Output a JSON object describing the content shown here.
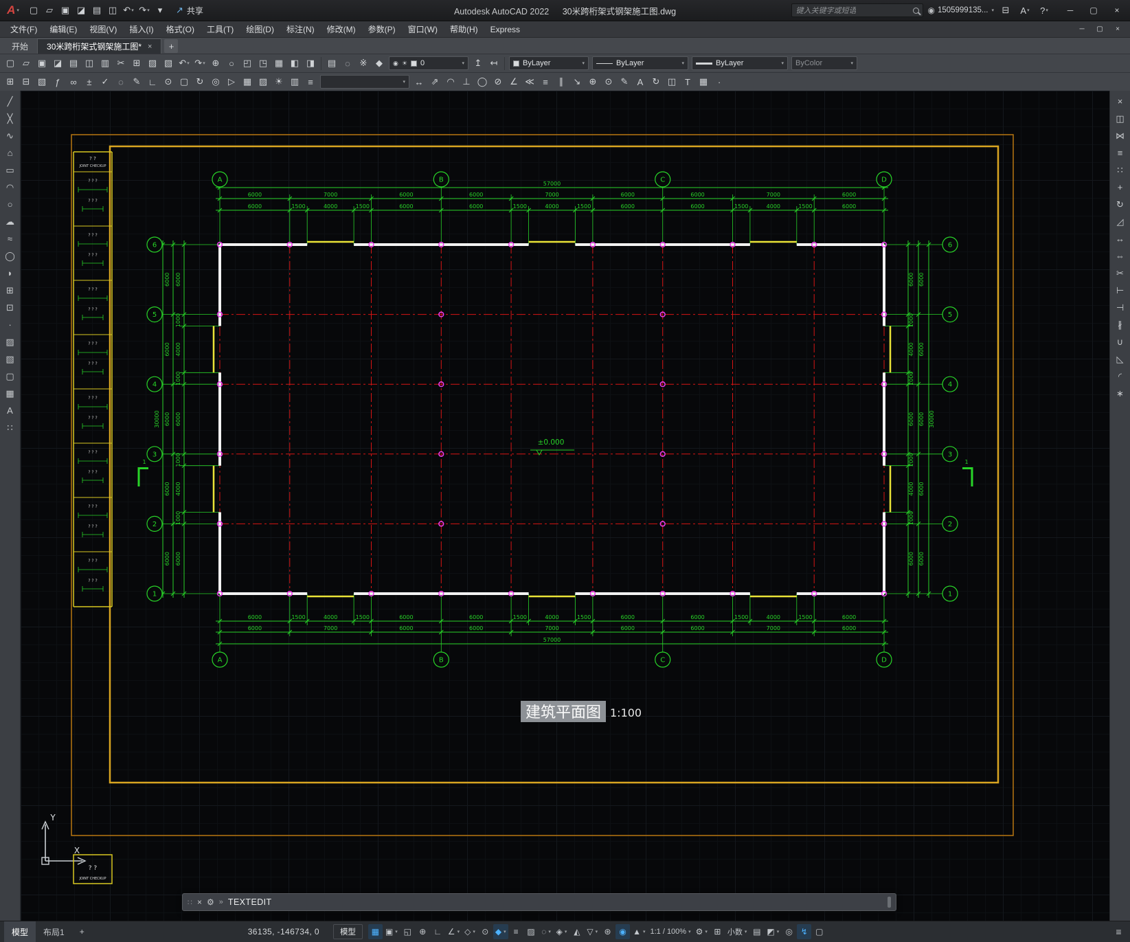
{
  "titlebar": {
    "logo_letter": "A",
    "app_title": "Autodesk AutoCAD 2022",
    "doc_title": "30米跨桁架式钢架施工图.dwg",
    "search_placeholder": "键入关键字或短语",
    "account_label": "1505999135...",
    "share_label": "共享",
    "qat": [
      {
        "name": "new-file",
        "glyph": "▢"
      },
      {
        "name": "open-file",
        "glyph": "▱"
      },
      {
        "name": "save",
        "glyph": "▣"
      },
      {
        "name": "save-as",
        "glyph": "◪"
      },
      {
        "name": "plot",
        "glyph": "▤"
      },
      {
        "name": "batch-plot",
        "glyph": "◫"
      },
      {
        "name": "undo",
        "glyph": "↶",
        "caret": true
      },
      {
        "name": "redo",
        "glyph": "↷",
        "caret": true
      },
      {
        "name": "qat-customize",
        "glyph": "▾"
      }
    ],
    "window_controls": [
      {
        "name": "minimize",
        "glyph": "─"
      },
      {
        "name": "maximize",
        "glyph": "▢"
      },
      {
        "name": "close",
        "glyph": "×"
      }
    ]
  },
  "menubar": {
    "items": [
      "文件(F)",
      "编辑(E)",
      "视图(V)",
      "插入(I)",
      "格式(O)",
      "工具(T)",
      "绘图(D)",
      "标注(N)",
      "修改(M)",
      "参数(P)",
      "窗口(W)",
      "帮助(H)",
      "Express"
    ],
    "window_controls": [
      {
        "name": "doc-minimize",
        "glyph": "─"
      },
      {
        "name": "doc-restore",
        "glyph": "▢"
      },
      {
        "name": "doc-close",
        "glyph": "×"
      }
    ]
  },
  "tabbar": {
    "start_tab": "开始",
    "doc_tab": "30米跨桁架式钢架施工图*"
  },
  "toolbar1": {
    "icons_main": [
      {
        "name": "qnew",
        "glyph": "▢"
      },
      {
        "name": "open",
        "glyph": "▱"
      },
      {
        "name": "save",
        "glyph": "▣"
      },
      {
        "name": "save-as",
        "glyph": "◪"
      },
      {
        "name": "plot",
        "glyph": "▤"
      },
      {
        "name": "plot-preview",
        "glyph": "◫"
      },
      {
        "name": "publish",
        "glyph": "▥"
      },
      {
        "name": "cut",
        "glyph": "✂"
      },
      {
        "name": "copy",
        "glyph": "⊞"
      },
      {
        "name": "paste",
        "glyph": "▨"
      },
      {
        "name": "match-properties",
        "glyph": "▧"
      },
      {
        "name": "undo",
        "glyph": "↶",
        "caret": true
      },
      {
        "name": "redo",
        "glyph": "↷",
        "caret": true
      },
      {
        "name": "pan",
        "glyph": "⊕"
      },
      {
        "name": "zoom-realtime",
        "glyph": "○"
      },
      {
        "name": "zoom-window",
        "glyph": "◰"
      },
      {
        "name": "zoom-previous",
        "glyph": "◳"
      },
      {
        "name": "properties-palette",
        "glyph": "▦"
      },
      {
        "name": "design-center",
        "glyph": "◧"
      },
      {
        "name": "tool-palettes",
        "glyph": "◨"
      }
    ],
    "icons_layer": [
      {
        "name": "layer-properties",
        "glyph": "▤"
      },
      {
        "name": "layer-off",
        "glyph": "◌"
      },
      {
        "name": "layer-freeze",
        "glyph": "※"
      },
      {
        "name": "layer-lock",
        "glyph": "◆"
      }
    ],
    "layer_value": "0",
    "icons_layer2": [
      {
        "name": "make-object-layer-current",
        "glyph": "↥"
      },
      {
        "name": "layer-previous",
        "glyph": "↤"
      }
    ],
    "color_value": "ByLayer",
    "linetype_value": "ByLayer",
    "lineweight_value": "ByLayer",
    "plotstyle_value": "ByColor"
  },
  "toolbar2": {
    "icons_left": [
      {
        "name": "insert-block",
        "glyph": "⊞"
      },
      {
        "name": "attach-xref",
        "glyph": "⊟"
      },
      {
        "name": "attach-image",
        "glyph": "▧"
      },
      {
        "name": "field",
        "glyph": "ƒ"
      },
      {
        "name": "hyperlink",
        "glyph": "∞"
      },
      {
        "name": "quick-calc",
        "glyph": "±"
      },
      {
        "name": "spell-check",
        "glyph": "✓"
      },
      {
        "name": "find-replace",
        "glyph": "◌"
      },
      {
        "name": "markup",
        "glyph": "✎"
      },
      {
        "name": "ucs",
        "glyph": "∟"
      },
      {
        "name": "ucs-world",
        "glyph": "⊙"
      },
      {
        "name": "named-views",
        "glyph": "▢"
      },
      {
        "name": "3d-orbit",
        "glyph": "↻"
      },
      {
        "name": "steering-wheel",
        "glyph": "◎"
      },
      {
        "name": "show-motion",
        "glyph": "▷"
      },
      {
        "name": "render",
        "glyph": "▦"
      },
      {
        "name": "materials",
        "glyph": "▨"
      },
      {
        "name": "lights",
        "glyph": "☀"
      },
      {
        "name": "sheet-set-manager",
        "glyph": "▥"
      },
      {
        "name": "layer-walk",
        "glyph": "≡"
      }
    ],
    "style_value": "",
    "icons_right": [
      {
        "name": "dim-linear",
        "glyph": "↔"
      },
      {
        "name": "dim-aligned",
        "glyph": "⇗"
      },
      {
        "name": "dim-arc-length",
        "glyph": "◠"
      },
      {
        "name": "dim-ordinate",
        "glyph": "⊥"
      },
      {
        "name": "dim-radius",
        "glyph": "◯"
      },
      {
        "name": "dim-diameter",
        "glyph": "⊘"
      },
      {
        "name": "dim-angular",
        "glyph": "∠"
      },
      {
        "name": "quick-dimension",
        "glyph": "≪"
      },
      {
        "name": "dim-baseline",
        "glyph": "≡"
      },
      {
        "name": "dim-continue",
        "glyph": "∥"
      },
      {
        "name": "multileader",
        "glyph": "↘"
      },
      {
        "name": "tolerance",
        "glyph": "⊕"
      },
      {
        "name": "center-mark",
        "glyph": "⊙"
      },
      {
        "name": "dim-edit",
        "glyph": "✎"
      },
      {
        "name": "dim-text-edit",
        "glyph": "A"
      },
      {
        "name": "dim-update",
        "glyph": "↻"
      },
      {
        "name": "dim-style",
        "glyph": "◫"
      },
      {
        "name": "text-style",
        "glyph": "T"
      },
      {
        "name": "table-style",
        "glyph": "▦"
      },
      {
        "name": "point-style",
        "glyph": "∙"
      }
    ]
  },
  "left_palette": [
    {
      "name": "line",
      "glyph": "╱"
    },
    {
      "name": "construction-line",
      "glyph": "╳"
    },
    {
      "name": "polyline",
      "glyph": "∿"
    },
    {
      "name": "polygon",
      "glyph": "⌂"
    },
    {
      "name": "rectangle",
      "glyph": "▭"
    },
    {
      "name": "arc",
      "glyph": "◠"
    },
    {
      "name": "circle",
      "glyph": "○"
    },
    {
      "name": "revision-cloud",
      "glyph": "☁"
    },
    {
      "name": "spline",
      "glyph": "≈"
    },
    {
      "name": "ellipse",
      "glyph": "◯"
    },
    {
      "name": "ellipse-arc",
      "glyph": "◗"
    },
    {
      "name": "insert-block",
      "glyph": "⊞"
    },
    {
      "name": "make-block",
      "glyph": "⊡"
    },
    {
      "name": "point",
      "glyph": "∙"
    },
    {
      "name": "hatch",
      "glyph": "▨"
    },
    {
      "name": "gradient",
      "glyph": "▧"
    },
    {
      "name": "region",
      "glyph": "▢"
    },
    {
      "name": "table",
      "glyph": "▦"
    },
    {
      "name": "multiline-text",
      "glyph": "A"
    },
    {
      "name": "multiple-points",
      "glyph": "∷"
    }
  ],
  "right_palette": [
    {
      "name": "erase",
      "glyph": "×"
    },
    {
      "name": "copy-object",
      "glyph": "◫"
    },
    {
      "name": "mirror",
      "glyph": "⋈"
    },
    {
      "name": "offset",
      "glyph": "≡"
    },
    {
      "name": "array",
      "glyph": "∷"
    },
    {
      "name": "move",
      "glyph": "+"
    },
    {
      "name": "rotate",
      "glyph": "↻"
    },
    {
      "name": "scale",
      "glyph": "◿"
    },
    {
      "name": "stretch",
      "glyph": "↔"
    },
    {
      "name": "lengthen",
      "glyph": "⇔"
    },
    {
      "name": "trim",
      "glyph": "✂"
    },
    {
      "name": "extend",
      "glyph": "⊢"
    },
    {
      "name": "break-at-point",
      "glyph": "⊣"
    },
    {
      "name": "break",
      "glyph": "∦"
    },
    {
      "name": "join",
      "glyph": "∪"
    },
    {
      "name": "chamfer",
      "glyph": "◺"
    },
    {
      "name": "fillet",
      "glyph": "◜"
    },
    {
      "name": "explode",
      "glyph": "∗"
    }
  ],
  "command": {
    "prompt": "TEXTEDIT"
  },
  "statusbar": {
    "layout_tabs": [
      {
        "name": "model",
        "label": "模型",
        "active": true
      },
      {
        "name": "layout1",
        "label": "布局1"
      },
      {
        "name": "add-layout",
        "label": "+"
      }
    ],
    "coordinates": "36135, -146734, 0",
    "model_space_label": "模型",
    "items": [
      {
        "name": "grid-display",
        "glyph": "▦",
        "active": true
      },
      {
        "name": "snap-mode",
        "glyph": "▣",
        "caret": true
      },
      {
        "name": "infer-constraints",
        "glyph": "◱"
      },
      {
        "name": "dynamic-input",
        "glyph": "⊕"
      },
      {
        "name": "ortho-mode",
        "glyph": "∟"
      },
      {
        "name": "polar-tracking",
        "glyph": "∠",
        "caret": true
      },
      {
        "name": "isometric-drafting",
        "glyph": "◇",
        "caret": true
      },
      {
        "name": "object-snap-tracking",
        "glyph": "⊙"
      },
      {
        "name": "object-snap",
        "glyph": "◆",
        "active": true,
        "caret": true
      },
      {
        "name": "lineweight-display",
        "glyph": "≡"
      },
      {
        "name": "transparency",
        "glyph": "▨"
      },
      {
        "name": "selection-cycling",
        "glyph": "◌",
        "caret": true
      },
      {
        "name": "3d-object-snap",
        "glyph": "◈",
        "caret": true
      },
      {
        "name": "dynamic-ucs",
        "glyph": "◭"
      },
      {
        "name": "selection-filtering",
        "glyph": "▽",
        "caret": true
      },
      {
        "name": "gizmo",
        "glyph": "⊛"
      },
      {
        "name": "annotation-visibility",
        "glyph": "◉",
        "active": true
      },
      {
        "name": "autoscale",
        "glyph": "▲",
        "caret": true
      },
      {
        "name": "annotation-scale",
        "label": "1:1 / 100%",
        "caret": true
      },
      {
        "name": "workspace-switching",
        "glyph": "⚙",
        "caret": true
      },
      {
        "name": "annotation-monitor",
        "glyph": "⊞"
      },
      {
        "name": "units",
        "label": "小数",
        "caret": true
      },
      {
        "name": "quick-properties",
        "glyph": "▤"
      },
      {
        "name": "lock-ui",
        "glyph": "◩",
        "caret": true
      },
      {
        "name": "isolate-objects",
        "glyph": "◎"
      },
      {
        "name": "graphics-performance",
        "glyph": "↯",
        "active": true
      },
      {
        "name": "clean-screen",
        "glyph": "▢"
      }
    ]
  },
  "drawing": {
    "strip": {
      "header_marks": "?      ?",
      "label": "JOINT CHECKUP",
      "section_marks": "?    ?    ?",
      "section_count": 8
    },
    "col_axis_labels": [
      "A",
      "B",
      "C",
      "D"
    ],
    "col_axis_mm": [
      0,
      19000,
      38000,
      57000
    ],
    "row_axis_labels": [
      "6",
      "5",
      "4",
      "3",
      "2",
      "1"
    ],
    "row_axis_mm": [
      0,
      6000,
      12000,
      18000,
      24000,
      30000
    ],
    "total_width_label": "57000",
    "total_height_label": "30000",
    "bay_boundaries_mm": [
      0,
      6000,
      13000,
      19000,
      25000,
      32000,
      38000,
      44000,
      51000,
      57000
    ],
    "bay_labels": [
      "6000",
      "7000",
      "6000",
      "6000",
      "7000",
      "6000",
      "6000",
      "7000",
      "6000"
    ],
    "sub_boundaries_mm": [
      0,
      6000,
      7500,
      11500,
      13000,
      19000,
      25000,
      26500,
      30500,
      32000,
      38000,
      44000,
      45500,
      49500,
      51000,
      57000
    ],
    "sub_labels": [
      "6000",
      "1500",
      "4000",
      "1500",
      "6000",
      "6000",
      "1500",
      "4000",
      "1500",
      "6000",
      "6000",
      "1500",
      "4000",
      "1500",
      "6000"
    ],
    "vside_boundaries_mm": [
      0,
      6000,
      12000,
      18000,
      24000,
      30000
    ],
    "vside_labels": [
      "6000",
      "6000",
      "6000",
      "6000",
      "6000"
    ],
    "vsub_boundaries_mm": [
      0,
      6000,
      7000,
      11000,
      12000,
      18000,
      19000,
      23000,
      24000,
      30000
    ],
    "vsub_labels": [
      "6000",
      "1000",
      "4000",
      "1000",
      "6000",
      "1000",
      "4000",
      "1000",
      "6000"
    ],
    "wall_openings_h_mm": [
      [
        7500,
        11500
      ],
      [
        26500,
        30500
      ],
      [
        45500,
        49500
      ]
    ],
    "wall_openings_v_mm": [
      [
        7000,
        11000
      ],
      [
        19000,
        23000
      ]
    ],
    "elevation_label": "±0.000",
    "section_label": "1",
    "plan_title": "建筑平面图",
    "plan_scale": "1:100",
    "ucs": {
      "x": "X",
      "y": "Y"
    },
    "colors": {
      "green": "#28d428",
      "red": "#d81414",
      "magenta": "#f03cf0",
      "yellow": "#e9e337",
      "white": "#f2f2f2",
      "frame_outer": "#b87711",
      "frame_inner": "#d9a521",
      "strip_yellow": "#d9c821"
    }
  }
}
